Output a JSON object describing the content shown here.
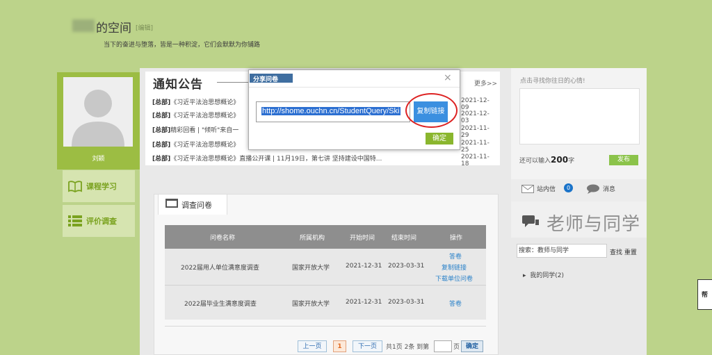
{
  "page": {
    "title": "的空间",
    "edit_label": "[编辑]",
    "motto": "当下的奋进与堕落，皆是一种积淀，它们会默默为你铺路"
  },
  "profile": {
    "name": "刘颖"
  },
  "nav": {
    "items": [
      {
        "label": "课程学习",
        "icon": "book-icon"
      },
      {
        "label": "评价调查",
        "icon": "list-icon"
      }
    ]
  },
  "notices": {
    "title": "通知公告",
    "more": "更多>>",
    "items": [
      {
        "tag": "[总部]",
        "text": "《习近平法治思想概论》",
        "date": "2021-12-09"
      },
      {
        "tag": "[总部]",
        "text": "《习近平法治思想概论》",
        "date": "2021-12-03"
      },
      {
        "tag": "[总部]",
        "text": "精彩回看 | \"倾听\"来自一",
        "date": "2021-11-29"
      },
      {
        "tag": "[总部]",
        "text": "《习近平法治思想概论》",
        "date": "2021-11-25"
      },
      {
        "tag": "[总部]",
        "text": "《习近平法治思想概论》直播公开课 | 11月19日，第七讲 坚持建设中国特...",
        "date": "2021-11-18"
      }
    ]
  },
  "mood": {
    "placeholder": "点击寻找你往日的心情!",
    "hint_prefix": "还可以输入",
    "hint_count": "200",
    "hint_suffix": "字",
    "publish": "发布"
  },
  "messages": {
    "inbox_label": "站内信",
    "inbox_count": "0",
    "chat_label": "消息"
  },
  "teachers": {
    "title": "老师与同学",
    "search_value": "搜索：教师与同学",
    "search_btn": "查找",
    "reset_btn": "重置",
    "group": "我的同学(2)"
  },
  "survey": {
    "tab": "调查问卷",
    "columns": [
      "问卷名称",
      "所属机构",
      "开始时间",
      "结束时间",
      "操作"
    ],
    "rows": [
      {
        "name": "2022届用人单位满意度调查",
        "org": "国家开放大学",
        "start": "2021-12-31",
        "end": "2023-03-31",
        "actions": [
          "答卷",
          "复制链接",
          "下载单位问卷"
        ]
      },
      {
        "name": "2022届毕业生满意度调查",
        "org": "国家开放大学",
        "start": "2021-12-31",
        "end": "2023-03-31",
        "actions": [
          "答卷"
        ]
      }
    ]
  },
  "pagination": {
    "prev": "上一页",
    "current": "1",
    "next": "下一页",
    "info": "共1页 2条 到第",
    "page_suffix": "页",
    "go": "确定"
  },
  "dialog": {
    "title": "分享问卷",
    "close": "×",
    "link": "http://shome.ouchn.cn/StudentQuery/Ski",
    "copy_btn": "复制链接",
    "confirm": "确定"
  },
  "help": {
    "label": "帮助"
  },
  "colors": {
    "background": "#bcd38a",
    "accent_green": "#9cbd43",
    "link_blue": "#2b82c9",
    "highlight_red": "#dd2222"
  }
}
